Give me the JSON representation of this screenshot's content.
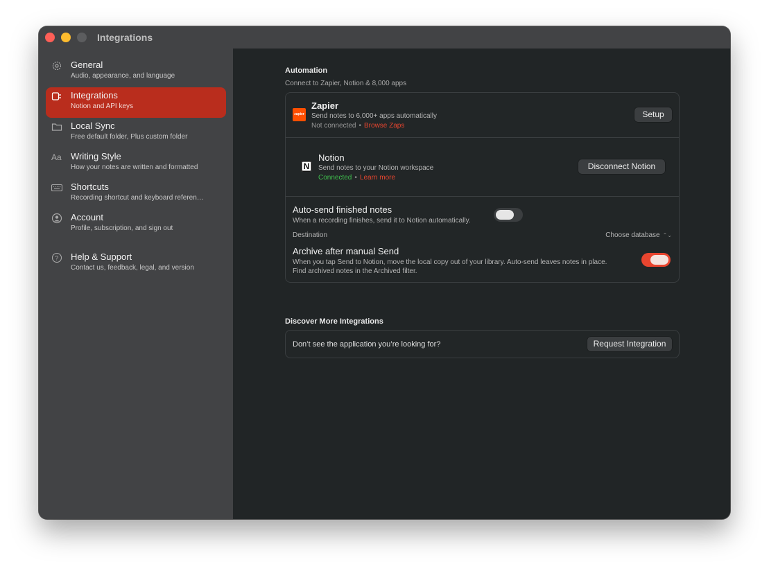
{
  "window": {
    "title": "Integrations"
  },
  "sidebar": {
    "items": [
      {
        "title": "General",
        "subtitle": "Audio, appearance, and language",
        "icon": "gear-icon"
      },
      {
        "title": "Integrations",
        "subtitle": "Notion and API keys",
        "icon": "plug-icon",
        "active": true
      },
      {
        "title": "Local Sync",
        "subtitle": "Free default folder, Plus custom folder",
        "icon": "folder-icon"
      },
      {
        "title": "Writing Style",
        "subtitle": "How your notes are written and formatted",
        "icon": "text-style-icon"
      },
      {
        "title": "Shortcuts",
        "subtitle": "Recording shortcut and keyboard referen…",
        "icon": "keyboard-icon"
      },
      {
        "title": "Account",
        "subtitle": "Profile, subscription, and sign out",
        "icon": "person-circle-icon"
      },
      {
        "title": "Help & Support",
        "subtitle": "Contact us, feedback, legal, and version",
        "icon": "question-circle-icon"
      }
    ]
  },
  "automation": {
    "title": "Automation",
    "subtitle": "Connect to Zapier, Notion & 8,000 apps",
    "zapier": {
      "logo_text": "zapier",
      "name": "Zapier",
      "description": "Send notes to 6,000+ apps automatically",
      "status": "Not connected",
      "separator": "•",
      "link": "Browse Zaps",
      "button": "Setup"
    },
    "notion": {
      "logo_text": "N",
      "name": "Notion",
      "description": "Send notes to your Notion workspace",
      "status": "Connected",
      "separator": "•",
      "link": "Learn more",
      "button": "Disconnect Notion"
    },
    "auto_send": {
      "title": "Auto-send finished notes",
      "description": "When a recording finishes, send it to Notion automatically.",
      "enabled": false
    },
    "destination": {
      "label": "Destination",
      "value": "Choose database",
      "chevron": "⌃⌄"
    },
    "archive": {
      "title": "Archive after manual Send",
      "description_line1": "When you tap Send to Notion, move the local copy out of your library. Auto-send leaves notes in place.",
      "description_line2": "Find archived notes in the Archived filter.",
      "enabled": true
    }
  },
  "discover": {
    "title": "Discover More Integrations",
    "prompt": "Don’t see the application you’re looking for?",
    "button": "Request Integration"
  },
  "colors": {
    "accent": "#e8452f",
    "active_nav": "#b92d1d",
    "connected": "#3fbf4d"
  }
}
